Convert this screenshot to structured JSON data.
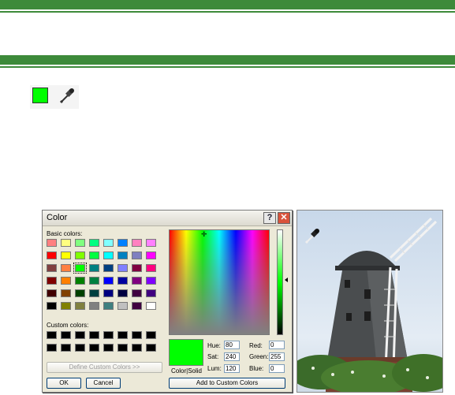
{
  "colors": {
    "band": "#3d8a3a",
    "current_color": "#00ff00",
    "dialog_bg": "#ece9d8"
  },
  "toolbar": {
    "swatch_color": "#00ff00",
    "dropper_icon": "eyedropper-icon"
  },
  "dialog": {
    "title": "Color",
    "help_label": "?",
    "close_label": "✕",
    "basic_colors_label": "Basic colors:",
    "custom_colors_label": "Custom colors:",
    "define_custom_label": "Define Custom Colors >>",
    "ok_label": "OK",
    "cancel_label": "Cancel",
    "add_custom_label": "Add to Custom Colors",
    "colorsolid_label": "Color|Solid",
    "basic_colors": [
      [
        "#ff8080",
        "#ffff80",
        "#80ff80",
        "#00ff80",
        "#80ffff",
        "#0080ff",
        "#ff80c0",
        "#ff80ff"
      ],
      [
        "#ff0000",
        "#ffff00",
        "#80ff00",
        "#00ff40",
        "#00ffff",
        "#0080c0",
        "#8080c0",
        "#ff00ff"
      ],
      [
        "#804040",
        "#ff8040",
        "#00ff00",
        "#008080",
        "#004080",
        "#8080ff",
        "#800040",
        "#ff0080"
      ],
      [
        "#800000",
        "#ff8000",
        "#008000",
        "#008040",
        "#0000ff",
        "#0000a0",
        "#800080",
        "#8000ff"
      ],
      [
        "#400000",
        "#804000",
        "#004000",
        "#004040",
        "#000080",
        "#000040",
        "#400040",
        "#400080"
      ],
      [
        "#000000",
        "#808000",
        "#808040",
        "#808080",
        "#408080",
        "#c0c0c0",
        "#400040",
        "#ffffff"
      ]
    ],
    "selected_basic": [
      2,
      2
    ],
    "custom_colors": [
      [
        "#000000",
        "#000000",
        "#000000",
        "#000000",
        "#000000",
        "#000000",
        "#000000",
        "#000000"
      ],
      [
        "#000000",
        "#000000",
        "#000000",
        "#000000",
        "#000000",
        "#000000",
        "#000000",
        "#000000"
      ]
    ],
    "fields": {
      "hue_label": "Hue:",
      "hue": "80",
      "sat_label": "Sat:",
      "sat": "240",
      "lum_label": "Lum:",
      "lum": "120",
      "red_label": "Red:",
      "red": "0",
      "green_label": "Green:",
      "green": "255",
      "blue_label": "Blue:",
      "blue": "0"
    }
  },
  "photo": {
    "dropper_icon": "eyedropper-icon"
  }
}
